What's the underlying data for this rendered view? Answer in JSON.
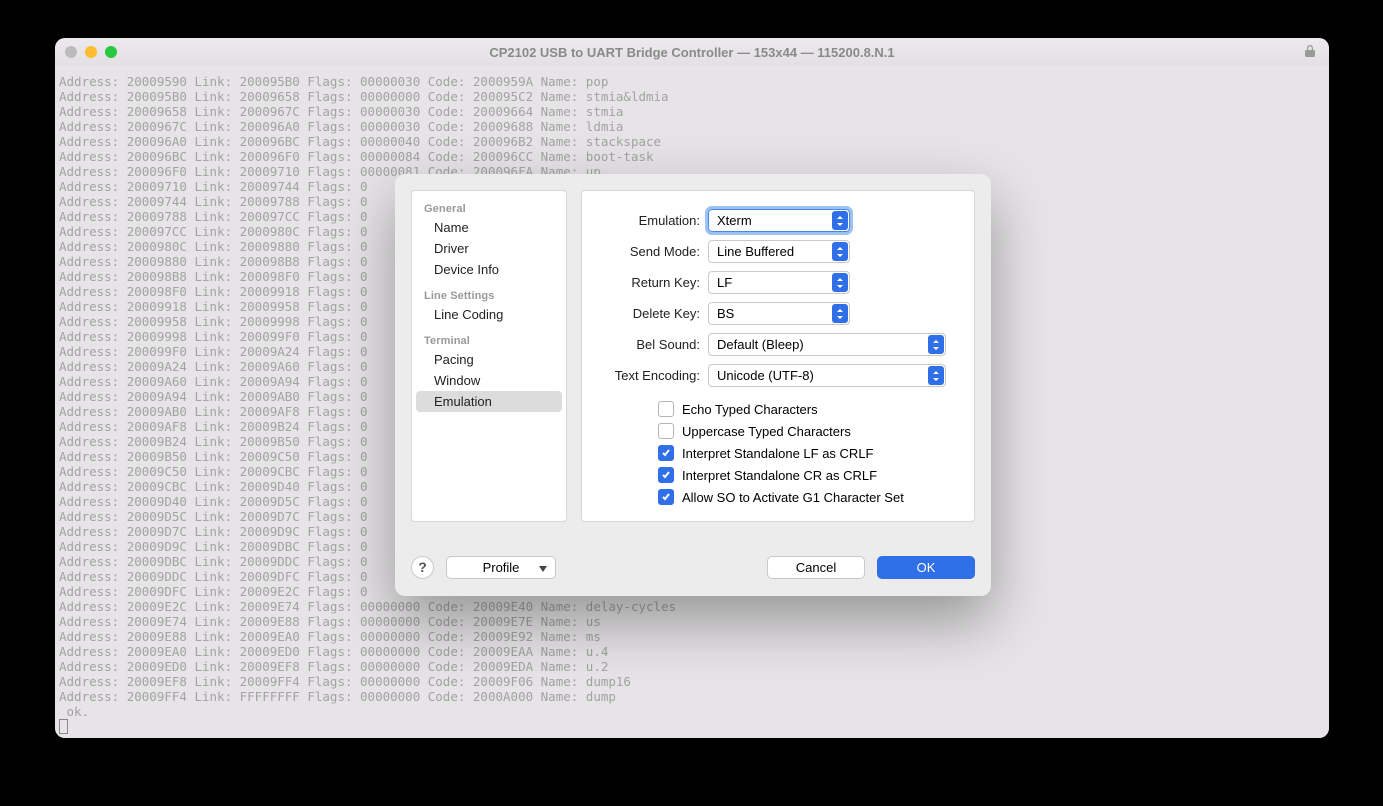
{
  "window": {
    "title": "CP2102 USB to UART Bridge Controller — 153x44 — 115200.8.N.1"
  },
  "terminal": {
    "lines": [
      "Address: 20009590 Link: 200095B0 Flags: 00000030 Code: 2000959A Name: pop",
      "Address: 200095B0 Link: 20009658 Flags: 00000000 Code: 200095C2 Name: stmia&ldmia",
      "Address: 20009658 Link: 2000967C Flags: 00000030 Code: 20009664 Name: stmia",
      "Address: 2000967C Link: 200096A0 Flags: 00000030 Code: 20009688 Name: ldmia",
      "Address: 200096A0 Link: 200096BC Flags: 00000040 Code: 200096B2 Name: stackspace",
      "Address: 200096BC Link: 200096F0 Flags: 00000084 Code: 200096CC Name: boot-task",
      "Address: 200096F0 Link: 20009710 Flags: 00000081 Code: 200096FA Name: up",
      "Address: 20009710 Link: 20009744 Flags: 0",
      "Address: 20009744 Link: 20009788 Flags: 0",
      "Address: 20009788 Link: 200097CC Flags: 0",
      "Address: 200097CC Link: 2000980C Flags: 0",
      "Address: 2000980C Link: 20009880 Flags: 0",
      "Address: 20009880 Link: 200098B8 Flags: 0",
      "Address: 200098B8 Link: 200098F0 Flags: 0",
      "Address: 200098F0 Link: 20009918 Flags: 0",
      "Address: 20009918 Link: 20009958 Flags: 0",
      "Address: 20009958 Link: 20009998 Flags: 0",
      "Address: 20009998 Link: 200099F0 Flags: 0",
      "Address: 200099F0 Link: 20009A24 Flags: 0",
      "Address: 20009A24 Link: 20009A60 Flags: 0",
      "Address: 20009A60 Link: 20009A94 Flags: 0",
      "Address: 20009A94 Link: 20009AB0 Flags: 0",
      "Address: 20009AB0 Link: 20009AF8 Flags: 0",
      "Address: 20009AF8 Link: 20009B24 Flags: 0",
      "Address: 20009B24 Link: 20009B50 Flags: 0",
      "Address: 20009B50 Link: 20009C50 Flags: 0",
      "Address: 20009C50 Link: 20009CBC Flags: 0",
      "Address: 20009CBC Link: 20009D40 Flags: 0",
      "Address: 20009D40 Link: 20009D5C Flags: 0",
      "Address: 20009D5C Link: 20009D7C Flags: 0",
      "Address: 20009D7C Link: 20009D9C Flags: 0",
      "Address: 20009D9C Link: 20009DBC Flags: 0",
      "Address: 20009DBC Link: 20009DDC Flags: 0",
      "Address: 20009DDC Link: 20009DFC Flags: 0",
      "Address: 20009DFC Link: 20009E2C Flags: 0",
      "Address: 20009E2C Link: 20009E74 Flags: 00000000 Code: 20009E40 Name: delay-cycles",
      "Address: 20009E74 Link: 20009E88 Flags: 00000000 Code: 20009E7E Name: us",
      "Address: 20009E88 Link: 20009EA0 Flags: 00000000 Code: 20009E92 Name: ms",
      "Address: 20009EA0 Link: 20009ED0 Flags: 00000000 Code: 20009EAA Name: u.4",
      "Address: 20009ED0 Link: 20009EF8 Flags: 00000000 Code: 20009EDA Name: u.2",
      "Address: 20009EF8 Link: 20009FF4 Flags: 00000000 Code: 20009F06 Name: dump16",
      "Address: 20009FF4 Link: FFFFFFFF Flags: 00000000 Code: 2000A000 Name: dump",
      " ok."
    ]
  },
  "dialog": {
    "sidebar": {
      "sections": [
        {
          "header": "General",
          "items": [
            "Name",
            "Driver",
            "Device Info"
          ]
        },
        {
          "header": "Line Settings",
          "items": [
            "Line Coding"
          ]
        },
        {
          "header": "Terminal",
          "items": [
            "Pacing",
            "Window",
            "Emulation"
          ]
        }
      ],
      "selected": "Emulation"
    },
    "form": {
      "emulation": {
        "label": "Emulation:",
        "value": "Xterm"
      },
      "send_mode": {
        "label": "Send Mode:",
        "value": "Line Buffered"
      },
      "return_key": {
        "label": "Return Key:",
        "value": "LF"
      },
      "delete_key": {
        "label": "Delete Key:",
        "value": "BS"
      },
      "bel_sound": {
        "label": "Bel Sound:",
        "value": "Default (Bleep)"
      },
      "text_encoding": {
        "label": "Text Encoding:",
        "value": "Unicode (UTF-8)"
      }
    },
    "checks": {
      "echo": {
        "label": "Echo Typed Characters",
        "checked": false
      },
      "uppercase": {
        "label": "Uppercase Typed Characters",
        "checked": false
      },
      "lf_crlf": {
        "label": "Interpret Standalone LF as CRLF",
        "checked": true
      },
      "cr_crlf": {
        "label": "Interpret Standalone CR as CRLF",
        "checked": true
      },
      "so_g1": {
        "label": "Allow SO to Activate G1 Character Set",
        "checked": true
      }
    },
    "footer": {
      "help": "?",
      "profile": "Profile",
      "cancel": "Cancel",
      "ok": "OK"
    }
  }
}
